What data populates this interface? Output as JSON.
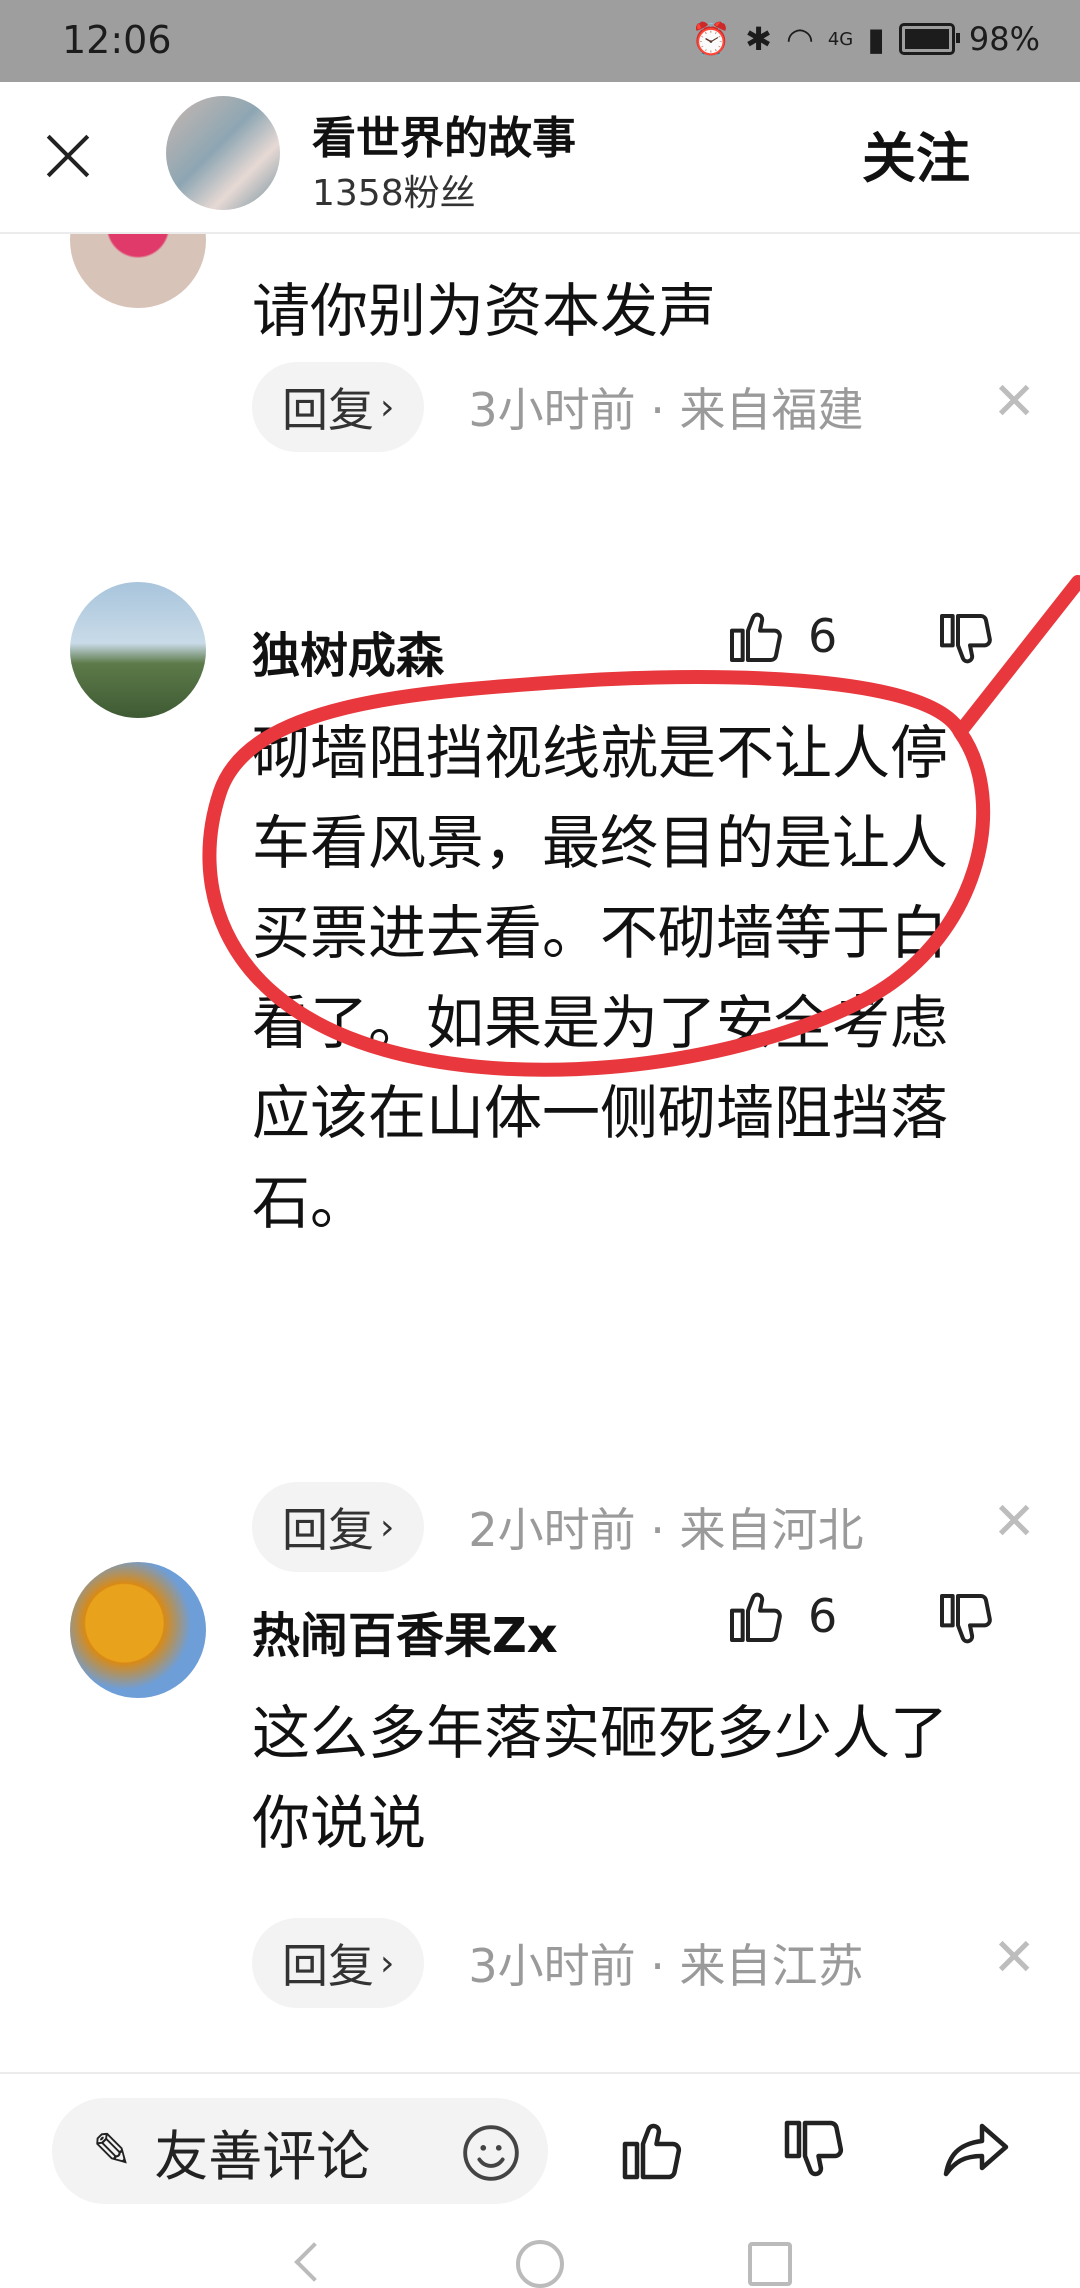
{
  "status_bar": {
    "time": "12:06",
    "network": "4G",
    "battery": "98%"
  },
  "header": {
    "author_name": "看世界的故事",
    "author_fans": "1358粉丝",
    "follow_label": "关注"
  },
  "comments": [
    {
      "content": "请你别为资本发声",
      "reply_label": "回复",
      "meta": "3小时前 · 来自福建"
    },
    {
      "username": "独树成森",
      "likes": "6",
      "content": "砌墙阻挡视线就是不让人停车看风景，最终目的是让人买票进去看。不砌墙等于白看了。如果是为了安全考虑应该在山体一侧砌墙阻挡落石。",
      "reply_label": "回复",
      "meta": "2小时前 · 来自河北"
    },
    {
      "username": "热闹百香果Zx",
      "likes": "6",
      "content": "这么多年落实砸死多少人了你说说",
      "reply_label": "回复",
      "meta": "3小时前 · 来自江苏"
    }
  ],
  "bottom_bar": {
    "comment_placeholder": "友善评论"
  },
  "colors": {
    "annotation": "#e8383d",
    "status_bar_bg": "#9e9e9e"
  }
}
